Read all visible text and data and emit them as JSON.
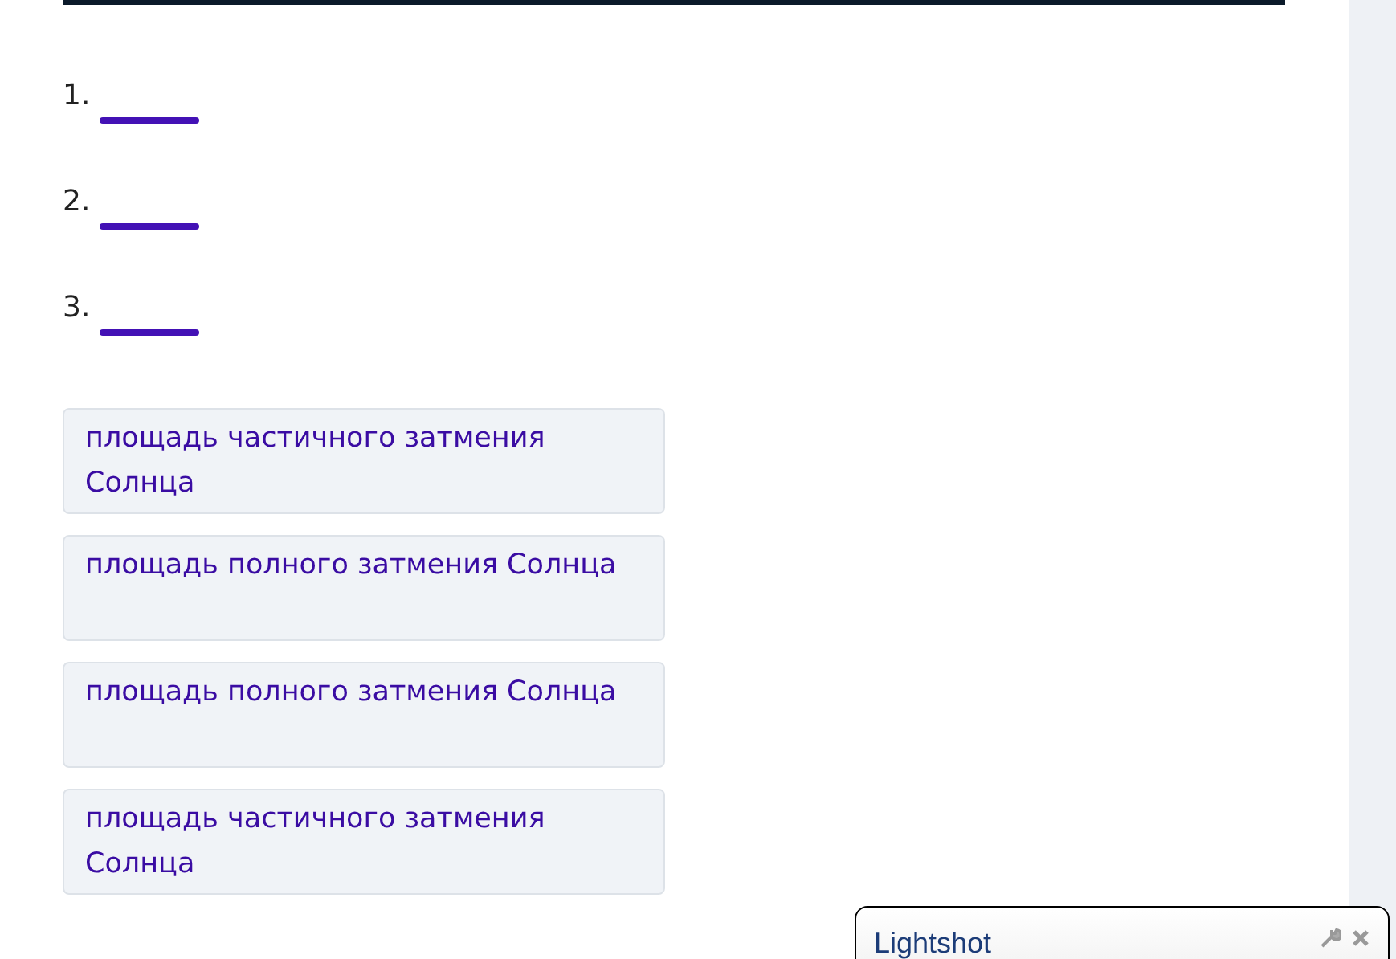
{
  "blanks": [
    {
      "number": "1."
    },
    {
      "number": "2."
    },
    {
      "number": "3."
    }
  ],
  "options": [
    {
      "text": "площадь частичного затмения Солнца"
    },
    {
      "text": "площадь полного затмения Солнца"
    },
    {
      "text": "площадь полного затмения Солнца"
    },
    {
      "text": "площадь частичного затмения Солнца"
    }
  ],
  "popup": {
    "title": "Lightshot"
  }
}
